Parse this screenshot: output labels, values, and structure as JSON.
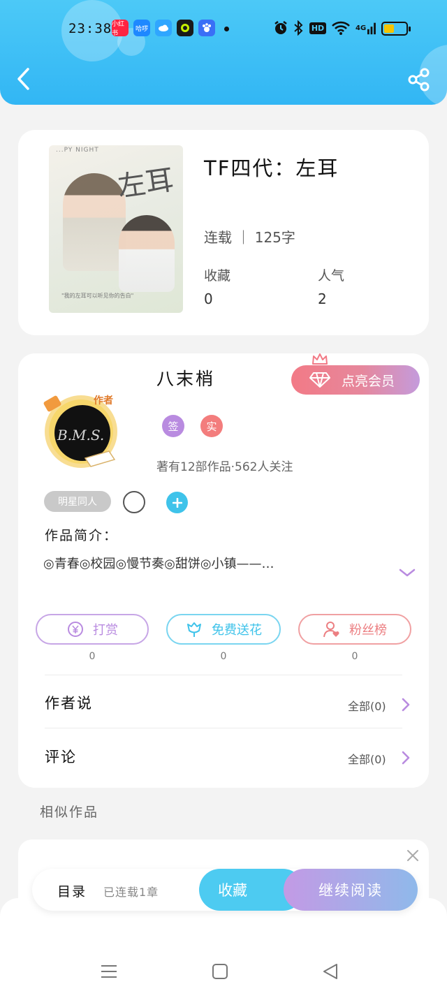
{
  "status_bar": {
    "time": "23:38",
    "apps": [
      {
        "name": "小红书",
        "color": "#ff2442"
      },
      {
        "name": "哈啰",
        "color": "#1e88ff"
      },
      {
        "name": "weather",
        "color": "#2fa6ff"
      },
      {
        "name": "camera",
        "color": "#1a1a1a"
      },
      {
        "name": "baidu",
        "color": "#3a6ff6"
      }
    ],
    "hd": "HD",
    "network": "4G"
  },
  "book": {
    "title": "TF四代：左耳",
    "status": "连载 ｜ 125字",
    "stats": [
      {
        "label": "收藏",
        "value": "0"
      },
      {
        "label": "人气",
        "value": "2"
      }
    ],
    "cover": {
      "title": "左耳",
      "top_text": "...PY NIGHT",
      "quote": "\"我的左耳可以听见你的告白\""
    }
  },
  "author": {
    "name": "八末梢",
    "vip_label": "点亮会员",
    "avatar_badge": "作者",
    "avatar_text": "B.M.S.",
    "badges": [
      {
        "label": "签",
        "color": "#b98be0"
      },
      {
        "label": "实",
        "color": "#f37d7d"
      }
    ],
    "works_follow": "著有12部作品·562人关注",
    "tag": "明星同人"
  },
  "intro": {
    "title": "作品简介：",
    "text": "◎青春◎校园◎慢节奏◎甜饼◎小镇——…"
  },
  "actions": [
    {
      "label": "打赏",
      "count": "0",
      "color": "#b98be0"
    },
    {
      "label": "免费送花",
      "count": "0",
      "color": "#3fc3ea"
    },
    {
      "label": "粉丝榜",
      "count": "0",
      "color": "#ec7f82"
    }
  ],
  "sections": [
    {
      "title": "作者说",
      "right": "全部(0)"
    },
    {
      "title": "评论",
      "right": "全部(0)"
    }
  ],
  "similar_title": "相似作品",
  "bottom_bar": {
    "toc": "目录",
    "toc_sub": "已连载1章",
    "favorite": "收藏",
    "continue": "继续阅读"
  },
  "colors": {
    "header": "#32b6f4",
    "accent_purple": "#b98be0",
    "accent_blue": "#3fc3ea",
    "accent_red": "#ec7f82"
  }
}
